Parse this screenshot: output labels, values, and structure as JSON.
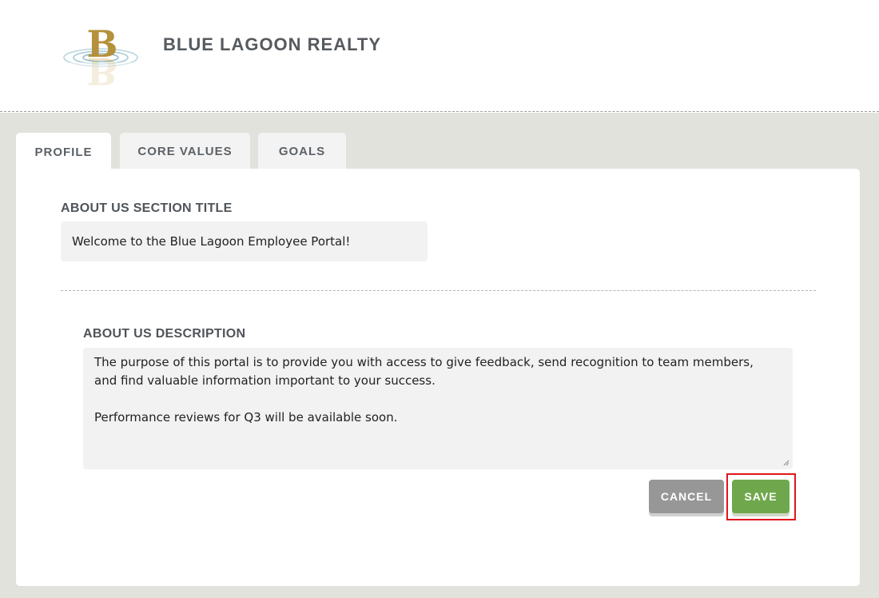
{
  "header": {
    "brand_name": "BLUE LAGOON REALTY",
    "logo_letter": "B",
    "logo_color": "#b4913a",
    "ripple_color": "#7fb3c4"
  },
  "tabs": [
    {
      "label": "PROFILE",
      "active": true
    },
    {
      "label": "CORE VALUES",
      "active": false
    },
    {
      "label": "GOALS",
      "active": false
    }
  ],
  "form": {
    "title_label": "ABOUT US SECTION TITLE",
    "title_value": "Welcome to the Blue Lagoon Employee Portal!",
    "description_label": "ABOUT US DESCRIPTION",
    "description_line1": "The purpose of this portal is to provide you with access to give feedback, send recognition to team members,",
    "description_line2": "and find valuable information important to your success.",
    "description_line3": "Performance reviews for Q3 will be available soon."
  },
  "buttons": {
    "cancel_label": "CANCEL",
    "save_label": "SAVE"
  },
  "colors": {
    "save": "#6fa84c",
    "cancel": "#979797",
    "highlight": "#e0161b",
    "background": "#e2e2dc"
  }
}
